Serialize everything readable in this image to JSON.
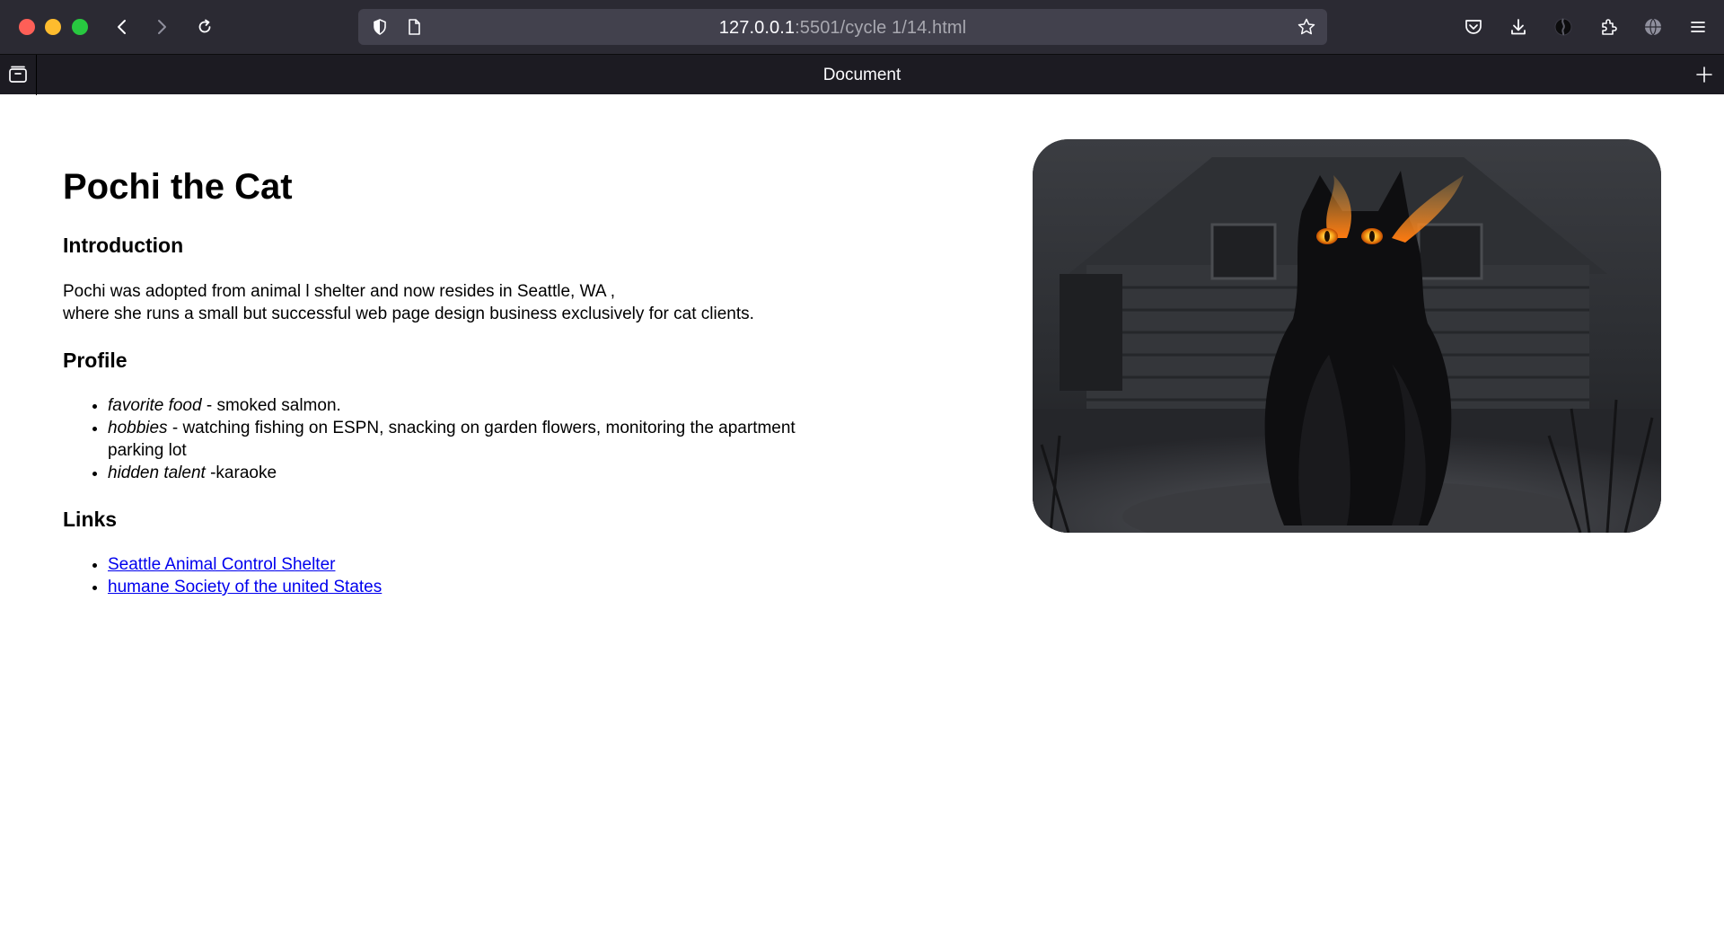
{
  "browser": {
    "url_host": "127.0.0.1",
    "url_rest": ":5501/cycle 1/14.html",
    "tab_title": "Document",
    "icons": [
      "back-icon",
      "forward-icon",
      "reload-icon",
      "shield-icon",
      "page-icon",
      "bookmark-star-icon",
      "pocket-icon",
      "download-icon",
      "account-icon",
      "extensions-icon",
      "globe-icon",
      "menu-icon",
      "tabs-icon",
      "new-tab-icon"
    ]
  },
  "page": {
    "title": "Pochi the Cat",
    "intro_heading": "Introduction",
    "intro_line1": "Pochi was adopted from animal l shelter and now resides in Seattle, WA ,",
    "intro_line2": "where she runs a small but successful web page design business exclusively for cat clients.",
    "profile_heading": "Profile",
    "profile": [
      {
        "label": "favorite food",
        "text": " - smoked salmon."
      },
      {
        "label": "hobbies",
        "text": " - watching fishing on ESPN, snacking on garden flowers, monitoring the apartment parking lot"
      },
      {
        "label": "hidden talent",
        "text": " -karaoke"
      }
    ],
    "links_heading": "Links",
    "links": [
      {
        "label": "Seattle Animal Control Shelter"
      },
      {
        "label": "humane Society of the united States"
      }
    ]
  },
  "colors": {
    "chrome_bg": "#2b2a33",
    "tabbar_bg": "#1c1b22",
    "urlbar_bg": "#42414d",
    "link": "#0000ee"
  }
}
